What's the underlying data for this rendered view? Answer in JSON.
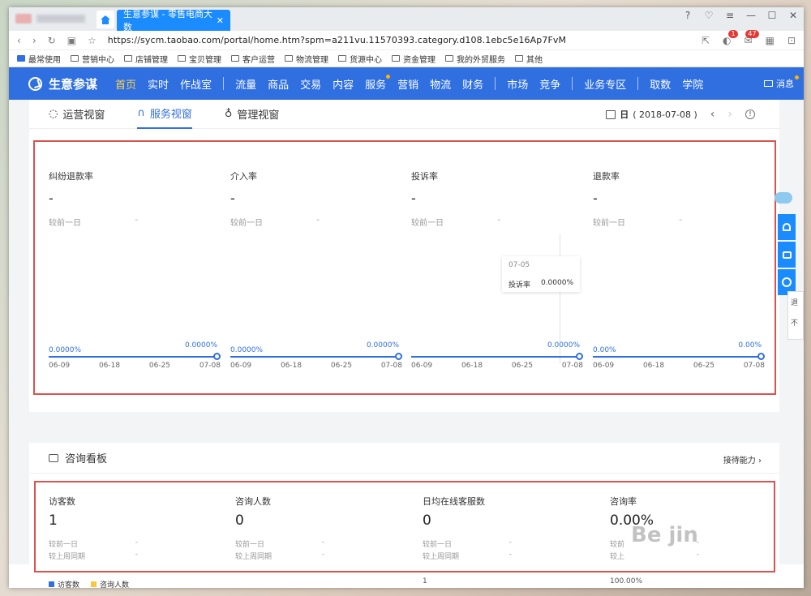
{
  "browser": {
    "active_tab_title": "生意参谋 - 零售电商大数",
    "url": "https://sycm.taobao.com/portal/home.htm?spm=a211vu.11570393.category.d108.1ebc5e16Ap7FvM",
    "badge_shield": "1",
    "badge_mail": "47",
    "bookmarks": [
      "最常使用",
      "营销中心",
      "店铺管理",
      "宝贝管理",
      "客户运营",
      "物流管理",
      "货源中心",
      "资金管理",
      "我的外贸服务",
      "其他"
    ]
  },
  "nav": {
    "logo": "生意参谋",
    "group1": [
      "首页",
      "实时",
      "作战室"
    ],
    "group2": [
      "流量",
      "商品",
      "交易",
      "内容",
      "服务",
      "营销",
      "物流",
      "财务"
    ],
    "group3": [
      "市场",
      "竞争"
    ],
    "group4": [
      "业务专区"
    ],
    "group5": [
      "取数",
      "学院"
    ],
    "message": "消息"
  },
  "views": {
    "items": [
      "运营视窗",
      "服务视窗",
      "管理视窗"
    ],
    "date_prefix": "日",
    "date": "( 2018-07-08 )"
  },
  "service_metrics": [
    {
      "name": "纠纷退款率",
      "value": "-",
      "compare_label": "较前一日",
      "compare_value": "-",
      "chart_start": "0.0000%",
      "chart_end": "0.0000%"
    },
    {
      "name": "介入率",
      "value": "-",
      "compare_label": "较前一日",
      "compare_value": "-",
      "chart_start": "0.0000%",
      "chart_end": "0.0000%"
    },
    {
      "name": "投诉率",
      "value": "-",
      "compare_label": "较前一日",
      "compare_value": "-",
      "chart_start": "",
      "chart_end": "0.0000%"
    },
    {
      "name": "退款率",
      "value": "-",
      "compare_label": "较前一日",
      "compare_value": "-",
      "chart_start": "0.00%",
      "chart_end": "0.00%"
    }
  ],
  "chart_ticks": [
    "06-09",
    "06-18",
    "06-25",
    "07-08"
  ],
  "tooltip": {
    "date": "07-05",
    "label": "投诉率",
    "value": "0.0000%"
  },
  "consult": {
    "title": "咨询看板",
    "ability_link": "接待能力",
    "metrics": [
      {
        "name": "访客数",
        "value": "1",
        "row1": "较前一日",
        "row2": "较上周同期",
        "v1": "-",
        "v2": "-"
      },
      {
        "name": "咨询人数",
        "value": "0",
        "row1": "较前一日",
        "row2": "较上周同期",
        "v1": "-",
        "v2": "-"
      },
      {
        "name": "日均在线客服数",
        "value": "0",
        "row1": "较前一日",
        "row2": "较上周同期",
        "v1": "-",
        "v2": "-"
      },
      {
        "name": "咨询率",
        "value": "0.00%",
        "row1": "较前",
        "row2": "较上",
        "v1": "-",
        "v2": "-"
      }
    ],
    "legend": [
      "访客数",
      "咨询人数"
    ],
    "axis_left_top": "1",
    "axis_right_top": "100.00%"
  },
  "side_right": [
    "退",
    "不"
  ],
  "watermark": "Be jin"
}
